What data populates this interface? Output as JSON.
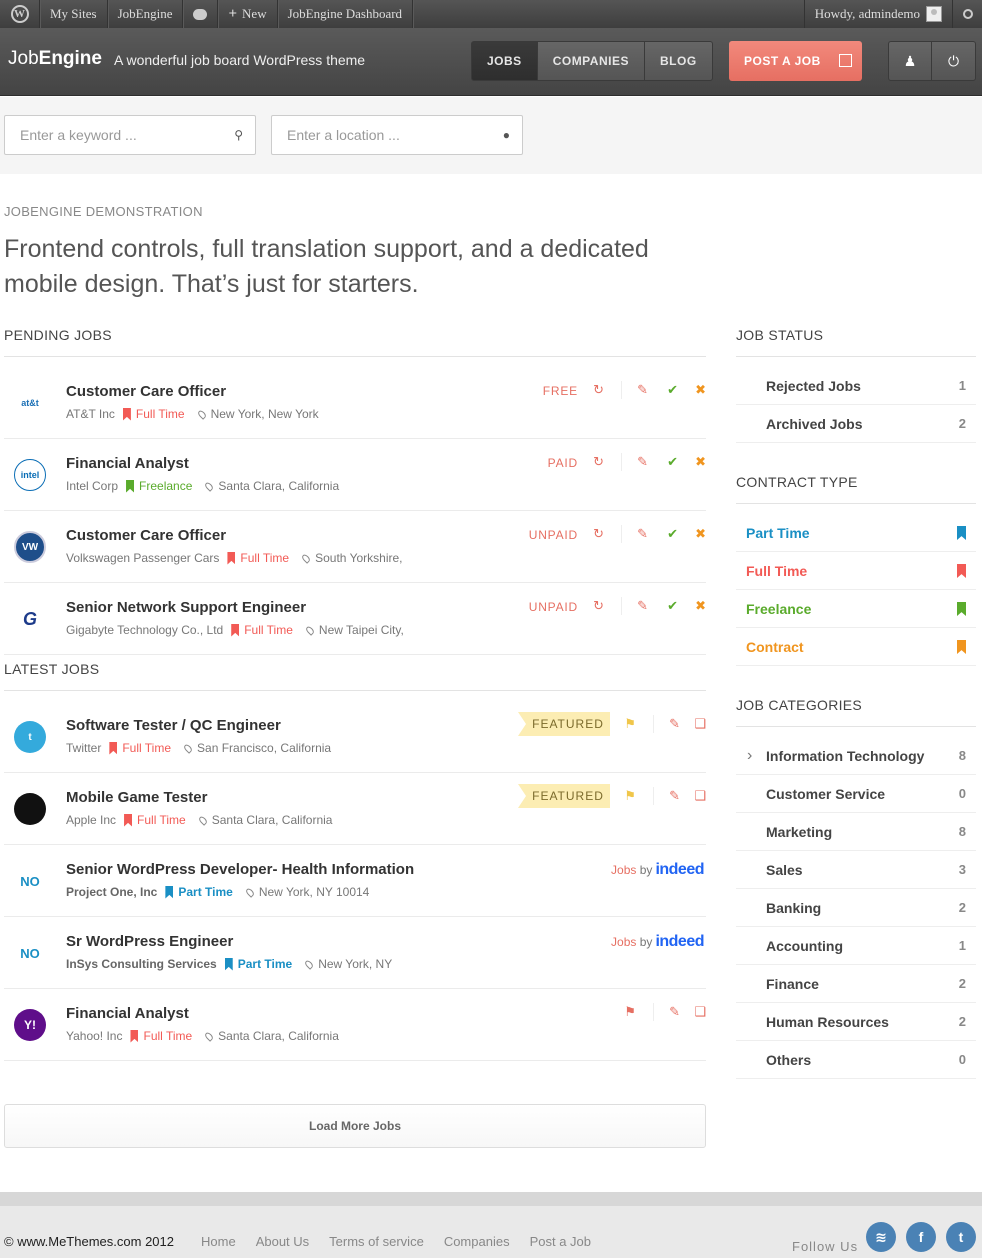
{
  "adminbar": {
    "items": [
      "My Sites",
      "JobEngine",
      "New",
      "JobEngine Dashboard"
    ],
    "howdy": "Howdy, admindemo"
  },
  "header": {
    "logo_light": "Job",
    "logo_bold": "Engine",
    "tagline": "A wonderful job board WordPress theme",
    "nav": [
      "JOBS",
      "COMPANIES",
      "BLOG"
    ],
    "post_job": "POST A JOB"
  },
  "search": {
    "keyword_placeholder": "Enter a keyword ...",
    "location_placeholder": "Enter a location ..."
  },
  "intro": {
    "eyebrow": "JOBENGINE DEMONSTRATION",
    "headline": "Frontend controls, full translation support, and a dedicated mobile design. That’s just for starters."
  },
  "pending": {
    "title": "PENDING JOBS",
    "jobs": [
      {
        "title": "Customer Care Officer",
        "company": "AT&T Inc",
        "type": "Full Time",
        "location": "New York, New York",
        "status": "FREE",
        "logo": "at&t"
      },
      {
        "title": "Financial Analyst",
        "company": "Intel Corp",
        "type": "Freelance",
        "location": "Santa Clara, California",
        "status": "PAID",
        "logo": "intel"
      },
      {
        "title": "Customer Care Officer",
        "company": "Volkswagen Passenger Cars",
        "type": "Full Time",
        "location": "South Yorkshire,",
        "status": "UNPAID",
        "logo": "VW"
      },
      {
        "title": "Senior Network Support Engineer",
        "company": "Gigabyte Technology Co., Ltd",
        "type": "Full Time",
        "location": "New Taipei City,",
        "status": "UNPAID",
        "logo": "G"
      }
    ]
  },
  "latest": {
    "title": "LATEST JOBS",
    "featured_label": "FEATURED",
    "jobs_by": "Jobs",
    "by": "by",
    "indeed": "indeed",
    "jobs": [
      {
        "title": "Software Tester / QC Engineer",
        "company": "Twitter",
        "type": "Full Time",
        "location": "San Francisco, California",
        "badge": "featured"
      },
      {
        "title": "Mobile Game Tester",
        "company": "Apple Inc",
        "type": "Full Time",
        "location": "Santa Clara, California",
        "badge": "featured"
      },
      {
        "title": "Senior WordPress Developer- Health Information",
        "company": "Project One, Inc",
        "type": "Part Time",
        "location": "New York, NY 10014",
        "badge": "indeed"
      },
      {
        "title": "Sr WordPress Engineer",
        "company": "InSys Consulting Services",
        "type": "Part Time",
        "location": "New York, NY",
        "badge": "indeed"
      },
      {
        "title": "Financial Analyst",
        "company": "Yahoo! Inc",
        "type": "Full Time",
        "location": "Santa Clara, California",
        "badge": "none"
      }
    ],
    "load_more": "Load More Jobs"
  },
  "sidebar": {
    "status_title": "JOB STATUS",
    "status": [
      {
        "label": "Rejected Jobs",
        "count": "1"
      },
      {
        "label": "Archived Jobs",
        "count": "2"
      }
    ],
    "contract_title": "CONTRACT TYPE",
    "contracts": [
      {
        "label": "Part Time",
        "color": "#1a8fc4"
      },
      {
        "label": "Full Time",
        "color": "#f25a55"
      },
      {
        "label": "Freelance",
        "color": "#5aab2c"
      },
      {
        "label": "Contract",
        "color": "#f0951f"
      }
    ],
    "categories_title": "JOB CATEGORIES",
    "categories": [
      {
        "label": "Information Technology",
        "count": "8"
      },
      {
        "label": "Customer Service",
        "count": "0"
      },
      {
        "label": "Marketing",
        "count": "8"
      },
      {
        "label": "Sales",
        "count": "3"
      },
      {
        "label": "Banking",
        "count": "2"
      },
      {
        "label": "Accounting",
        "count": "1"
      },
      {
        "label": "Finance",
        "count": "2"
      },
      {
        "label": "Human Resources",
        "count": "2"
      },
      {
        "label": "Others",
        "count": "0"
      }
    ]
  },
  "footer": {
    "copyright_site": "© www.MeThemes.com",
    "copyright_year": "2012",
    "links": [
      "Home",
      "About Us",
      "Terms of service",
      "Companies",
      "Post a Job"
    ],
    "follow": "Follow Us"
  },
  "colors": {
    "Full Time": "#f25a55",
    "Part Time": "#1a8fc4",
    "Freelance": "#5aab2c",
    "Contract": "#f0951f",
    "accent": "#e66f62"
  }
}
